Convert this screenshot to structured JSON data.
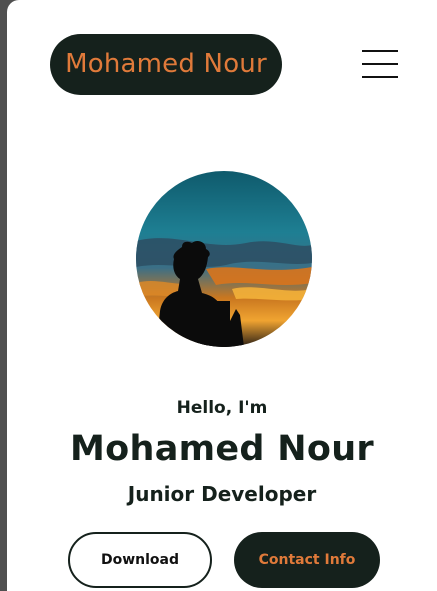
{
  "header": {
    "logo_text": "Mohamed Nour",
    "menu_icon": "hamburger-menu-icon"
  },
  "profile": {
    "avatar_alt": "profile-photo-silhouette-at-sunset"
  },
  "hero": {
    "greeting": "Hello, I'm",
    "name": "Mohamed Nour",
    "role": "Junior Developer"
  },
  "actions": {
    "download_label": "Download",
    "contact_label": "Contact Info"
  },
  "colors": {
    "dark": "#15211c",
    "accent": "#e07a3a",
    "background": "#ffffff"
  }
}
